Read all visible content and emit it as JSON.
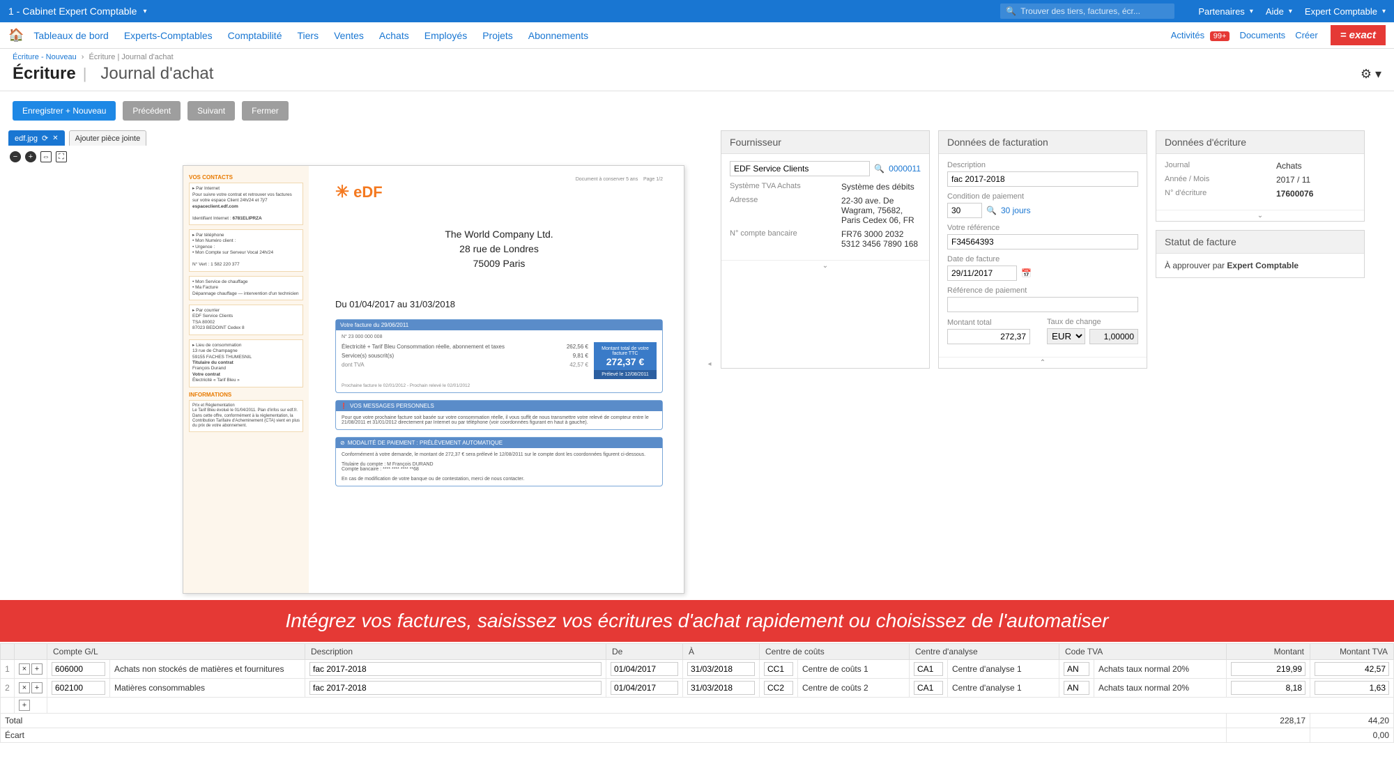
{
  "topbar": {
    "company": "1 - Cabinet Expert Comptable",
    "search_placeholder": "Trouver des tiers, factures, écr...",
    "partners": "Partenaires",
    "help": "Aide",
    "user": "Expert Comptable"
  },
  "nav": {
    "items": [
      "Tableaux de bord",
      "Experts-Comptables",
      "Comptabilité",
      "Tiers",
      "Ventes",
      "Achats",
      "Employés",
      "Projets",
      "Abonnements"
    ],
    "activities": "Activités",
    "activities_badge": "99+",
    "documents": "Documents",
    "create": "Créer",
    "logo": "= exact"
  },
  "breadcrumb": {
    "a": "Écriture - Nouveau",
    "b": "Écriture | Journal d'achat"
  },
  "title": {
    "main": "Écriture",
    "sub": "Journal d'achat"
  },
  "actions": {
    "save_new": "Enregistrer + Nouveau",
    "prev": "Précédent",
    "next": "Suivant",
    "close": "Fermer"
  },
  "attachment": {
    "tab": "edf.jpg",
    "add": "Ajouter pièce jointe"
  },
  "doc": {
    "brand": "eDF",
    "company": "The World Company Ltd.",
    "addr1": "28 rue de Londres",
    "addr2": "75009 Paris",
    "period": "Du 01/04/2017 au 31/03/2018",
    "contacts_title": "VOS CONTACTS",
    "infos_title": "INFORMATIONS",
    "msg_title": "VOS MESSAGES PERSONNELS",
    "pay_title": "MODALITÉ DE PAIEMENT : PRÉLÈVEMENT AUTOMATIQUE",
    "invoice_title": "Votre facture du 29/06/2011",
    "invoice_no": "N° 23 000 000 008",
    "row1_label": "Électricité + Tarif Bleu Consommation réelle, abonnement et taxes",
    "row1_val": "262,56 €",
    "row2_label": "Service(s) souscrit(s)",
    "row2_val": "9,81 €",
    "row3_label": "dont TVA",
    "row3_val": "42,57 €",
    "total_label": "Montant total de votre facture TTC",
    "total_val": "272,37 €",
    "deadline": "Prélevé le 12/08/2011"
  },
  "supplier": {
    "title": "Fournisseur",
    "name": "EDF Service Clients",
    "code": "0000011",
    "vat_label": "Système TVA Achats",
    "vat_val": "Système des débits",
    "addr_label": "Adresse",
    "addr_val": "22-30 ave. De Wagram, 75682, Paris Cedex 06, FR",
    "bank_label": "N° compte bancaire",
    "bank_val": "FR76 3000 2032 5312 3456 7890 168"
  },
  "billing": {
    "title": "Données de facturation",
    "desc_label": "Description",
    "desc_val": "fac 2017-2018",
    "cond_label": "Condition de paiement",
    "cond_val": "30",
    "cond_link": "30 jours",
    "ref_label": "Votre référence",
    "ref_val": "F34564393",
    "date_label": "Date de facture",
    "date_val": "29/11/2017",
    "payref_label": "Référence de paiement",
    "payref_val": "",
    "total_label": "Montant total",
    "total_val": "272,37",
    "rate_label": "Taux de change",
    "rate_cur": "EUR",
    "rate_val": "1,00000"
  },
  "entry": {
    "title": "Données d'écriture",
    "journal_label": "Journal",
    "journal_val": "Achats",
    "period_label": "Année / Mois",
    "period_val": "2017 / 11",
    "num_label": "N° d'écriture",
    "num_val": "17600076"
  },
  "status": {
    "title": "Statut de facture",
    "text": "À approuver par",
    "by": "Expert Comptable"
  },
  "banner": "Intégrez vos factures, saisissez vos écritures d'achat rapidement ou choisissez de l'automatiser",
  "grid": {
    "headers": {
      "gl": "Compte G/L",
      "desc": "Description",
      "from": "De",
      "to": "À",
      "cc": "Centre de coûts",
      "ca": "Centre d'analyse",
      "vat": "Code TVA",
      "amount": "Montant",
      "vat_amount": "Montant TVA"
    },
    "rows": [
      {
        "n": "1",
        "gl": "606000",
        "gl_name": "Achats non stockés de matières et fournitures",
        "desc": "fac 2017-2018",
        "from": "01/04/2017",
        "to": "31/03/2018",
        "cc": "CC1",
        "cc_name": "Centre de coûts 1",
        "ca": "CA1",
        "ca_name": "Centre d'analyse 1",
        "vat": "AN",
        "vat_name": "Achats taux normal 20%",
        "amount": "219,99",
        "vat_amount": "42,57"
      },
      {
        "n": "2",
        "gl": "602100",
        "gl_name": "Matières consommables",
        "desc": "fac 2017-2018",
        "from": "01/04/2017",
        "to": "31/03/2018",
        "cc": "CC2",
        "cc_name": "Centre de coûts 2",
        "ca": "CA1",
        "ca_name": "Centre d'analyse 1",
        "vat": "AN",
        "vat_name": "Achats taux normal 20%",
        "amount": "8,18",
        "vat_amount": "1,63"
      }
    ],
    "total_label": "Total",
    "total_amount": "228,17",
    "total_vat": "44,20",
    "diff_label": "Écart",
    "diff_amount": "0,00"
  }
}
